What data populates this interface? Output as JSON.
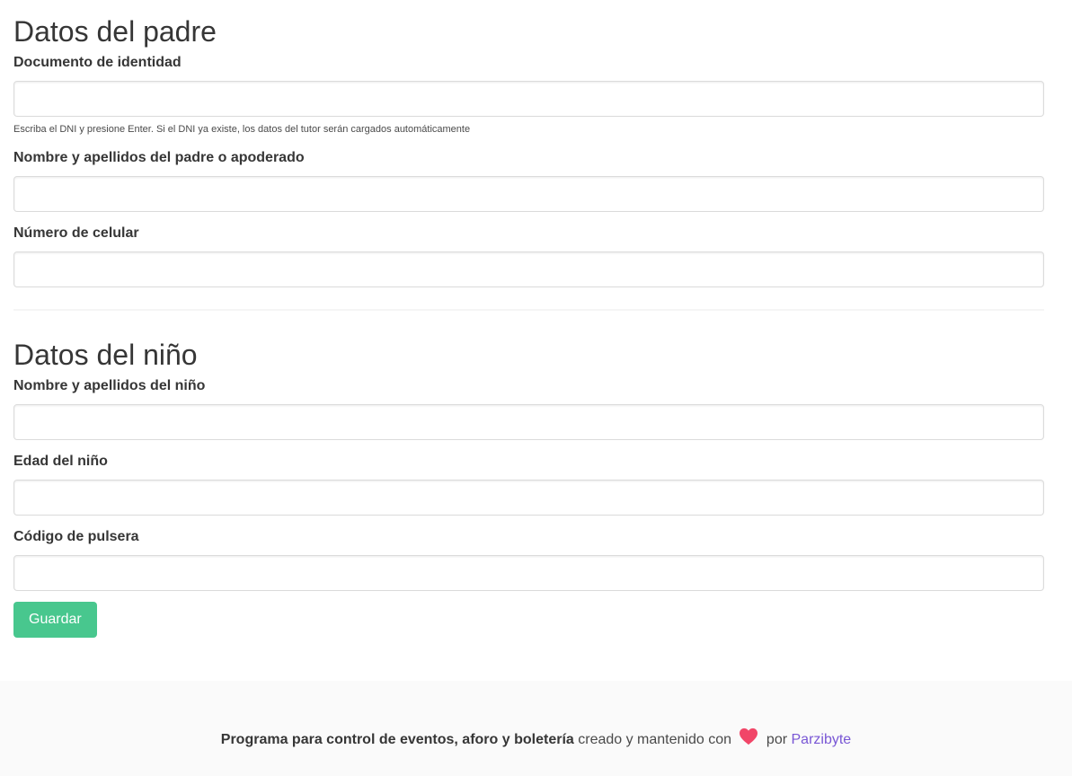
{
  "father": {
    "title": "Datos del padre",
    "dni_label": "Documento de identidad",
    "dni_value": "",
    "dni_help": "Escriba el DNI y presione Enter. Si el DNI ya existe, los datos del tutor serán cargados automáticamente",
    "name_label": "Nombre y apellidos del padre o apoderado",
    "name_value": "",
    "phone_label": "Número de celular",
    "phone_value": ""
  },
  "child": {
    "title": "Datos del niño",
    "name_label": "Nombre y apellidos del niño",
    "name_value": "",
    "age_label": "Edad del niño",
    "age_value": "",
    "bracelet_label": "Código de pulsera",
    "bracelet_value": ""
  },
  "actions": {
    "save_label": "Guardar"
  },
  "footer": {
    "product_text": "Programa para control de eventos, aforo y boletería",
    "made_text": "creado y mantenido con",
    "by_text": "por",
    "company_link": "Parzibyte",
    "heart_icon": "heart-icon"
  },
  "colors": {
    "primary": "#48c78e",
    "link": "#7957d5",
    "heart": "#f14668",
    "footer_bg": "#fafafa"
  }
}
